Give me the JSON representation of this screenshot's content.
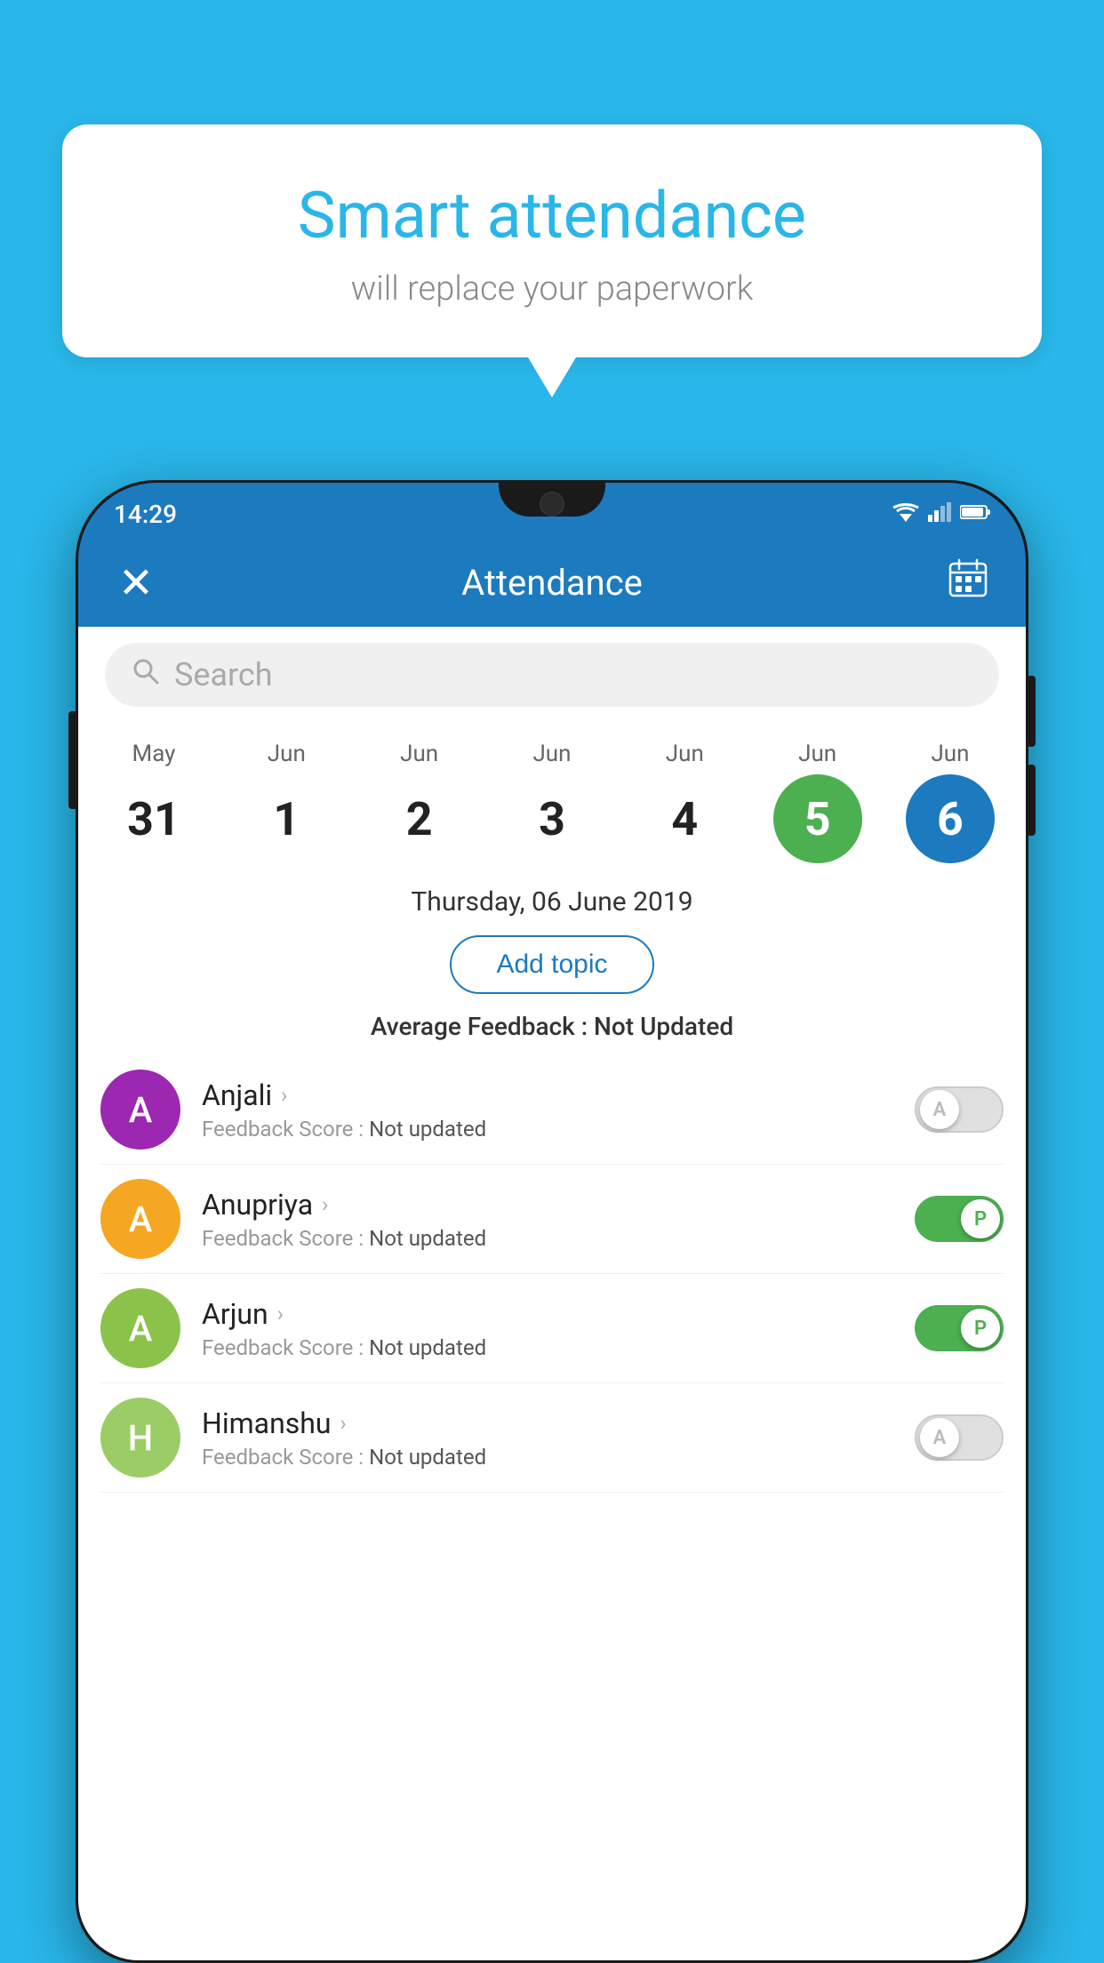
{
  "background_color": "#29b6e8",
  "bubble": {
    "title": "Smart attendance",
    "subtitle": "will replace your paperwork"
  },
  "status_bar": {
    "time": "14:29",
    "wifi": "▼",
    "signal": "▲",
    "battery": "▉"
  },
  "header": {
    "close_label": "✕",
    "title": "Attendance",
    "calendar_icon": "📅"
  },
  "search": {
    "placeholder": "Search"
  },
  "calendar": {
    "dates": [
      {
        "month": "May",
        "day": "31",
        "style": "normal"
      },
      {
        "month": "Jun",
        "day": "1",
        "style": "normal"
      },
      {
        "month": "Jun",
        "day": "2",
        "style": "normal"
      },
      {
        "month": "Jun",
        "day": "3",
        "style": "normal"
      },
      {
        "month": "Jun",
        "day": "4",
        "style": "normal"
      },
      {
        "month": "Jun",
        "day": "5",
        "style": "today"
      },
      {
        "month": "Jun",
        "day": "6",
        "style": "selected"
      }
    ],
    "selected_date": "Thursday, 06 June 2019"
  },
  "add_topic_label": "Add topic",
  "feedback": {
    "label": "Average Feedback :",
    "value": "Not Updated"
  },
  "students": [
    {
      "name": "Anjali",
      "avatar_letter": "A",
      "avatar_color": "#9c27b0",
      "feedback_label": "Feedback Score :",
      "feedback_value": "Not updated",
      "toggle_state": "off",
      "toggle_letter": "A"
    },
    {
      "name": "Anupriya",
      "avatar_letter": "A",
      "avatar_color": "#f5a623",
      "feedback_label": "Feedback Score :",
      "feedback_value": "Not updated",
      "toggle_state": "on",
      "toggle_letter": "P"
    },
    {
      "name": "Arjun",
      "avatar_letter": "A",
      "avatar_color": "#8bc34a",
      "feedback_label": "Feedback Score :",
      "feedback_value": "Not updated",
      "toggle_state": "on",
      "toggle_letter": "P"
    },
    {
      "name": "Himanshu",
      "avatar_letter": "H",
      "avatar_color": "#9ccc65",
      "feedback_label": "Feedback Score :",
      "feedback_value": "Not updated",
      "toggle_state": "off",
      "toggle_letter": "A"
    }
  ]
}
